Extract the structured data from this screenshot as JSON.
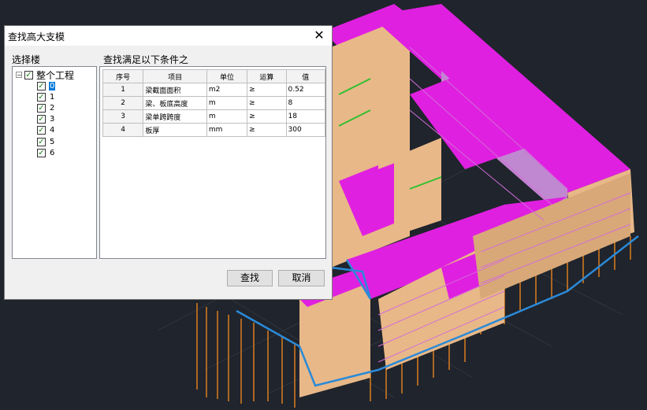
{
  "dialog": {
    "title": "查找高大支模",
    "floor_label": "选择楼",
    "condition_label": "查找满足以下条件之"
  },
  "tree": {
    "root": "整个工程",
    "floors": [
      "0",
      "1",
      "2",
      "3",
      "4",
      "5",
      "6"
    ]
  },
  "table": {
    "headers": [
      "序号",
      "项目",
      "单位",
      "运算",
      "值"
    ],
    "rows": [
      {
        "seq": "1",
        "item": "梁截面面积",
        "unit": "m2",
        "op": "≥",
        "value": "0.52"
      },
      {
        "seq": "2",
        "item": "梁、板底高度",
        "unit": "m",
        "op": "≥",
        "value": "8"
      },
      {
        "seq": "3",
        "item": "梁单跨跨度",
        "unit": "m",
        "op": "≥",
        "value": "18"
      },
      {
        "seq": "4",
        "item": "板厚",
        "unit": "mm",
        "op": "≥",
        "value": "300"
      }
    ]
  },
  "buttons": {
    "search": "查找",
    "cancel": "取消"
  },
  "colors": {
    "background": "#20242c",
    "slab": "#e020e0",
    "wall": "#e8b888",
    "column": "#d07820",
    "edge": "#2a8ad8"
  }
}
